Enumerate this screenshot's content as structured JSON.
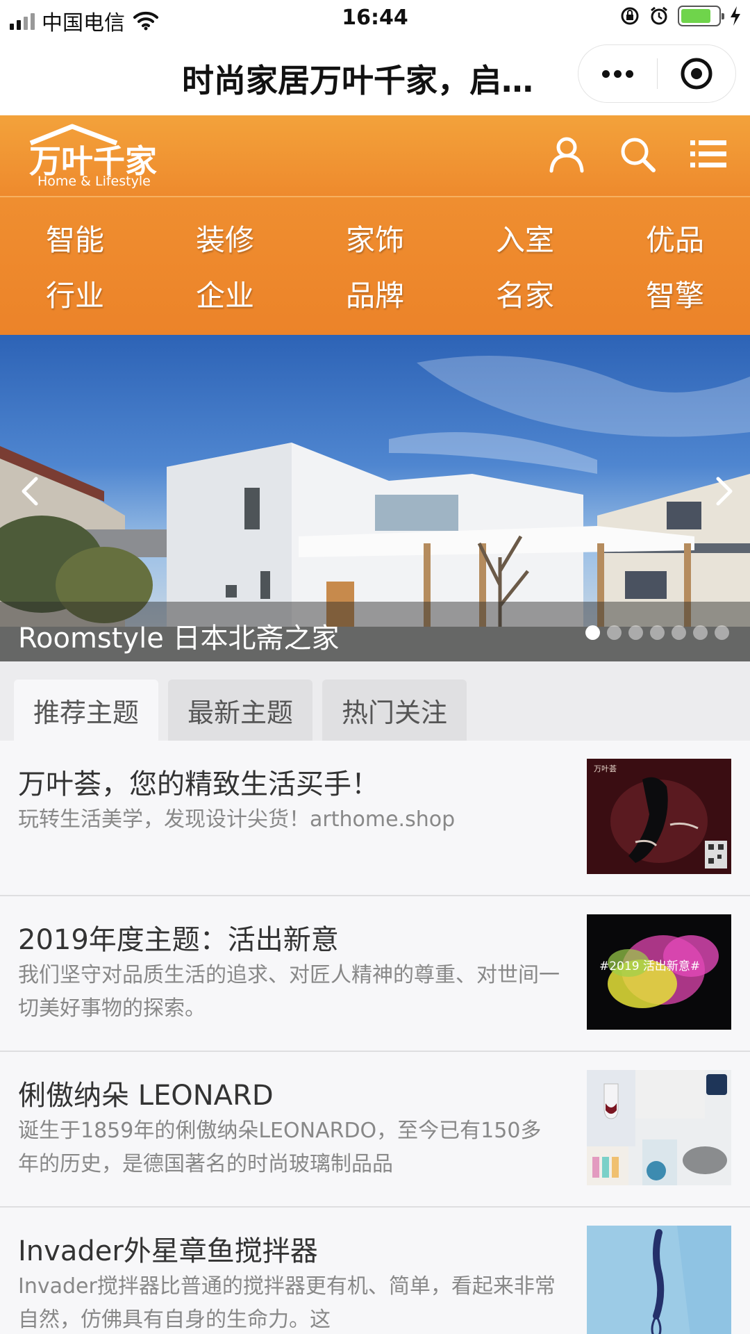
{
  "status_bar": {
    "carrier": "中国电信",
    "time": "16:44",
    "battery_level": 0.8
  },
  "title_bar": {
    "title": "时尚家居万叶千家，启…",
    "more_icon": "ellipsis-icon",
    "close_icon": "target-icon"
  },
  "header": {
    "logo_text": "万叶千家",
    "logo_subtitle": "Home & Lifestyle",
    "icons": [
      "user-icon",
      "search-icon",
      "menu-icon"
    ]
  },
  "categories": [
    "智能",
    "装修",
    "家饰",
    "入室",
    "优品",
    "行业",
    "企业",
    "品牌",
    "名家",
    "智擎"
  ],
  "banner": {
    "caption": "Roomstyle 日本北斋之家",
    "slide_count": 7,
    "active_slide": 1
  },
  "tabs": [
    "推荐主题",
    "最新主题",
    "热门关注"
  ],
  "active_tab": 0,
  "items": [
    {
      "title": "万叶荟，您的精致生活买手！",
      "desc": "玩转生活美学，发现设计尖货！arthome.shop",
      "thumb_text": "万叶荟"
    },
    {
      "title": "2019年度主题：活出新意",
      "desc": "我们坚守对品质生活的追求、对匠人精神的尊重、对世间一切美好事物的探索。",
      "thumb_text": "#2019 活出新意#"
    },
    {
      "title": "俐傲纳朵 LEONARD",
      "desc": "诞生于1859年的俐傲纳朵LEONARDO，至今已有150多年的历史，是德国著名的时尚玻璃制品品",
      "thumb_text": ""
    },
    {
      "title": "Invader外星章鱼搅拌器",
      "desc": "Invader搅拌器比普通的搅拌器更有机、简单，看起来非常自然，仿佛具有自身的生命力。这",
      "thumb_text": ""
    }
  ],
  "colors": {
    "header_orange": "#ee8a2d",
    "battery_green": "#6fd44b"
  }
}
